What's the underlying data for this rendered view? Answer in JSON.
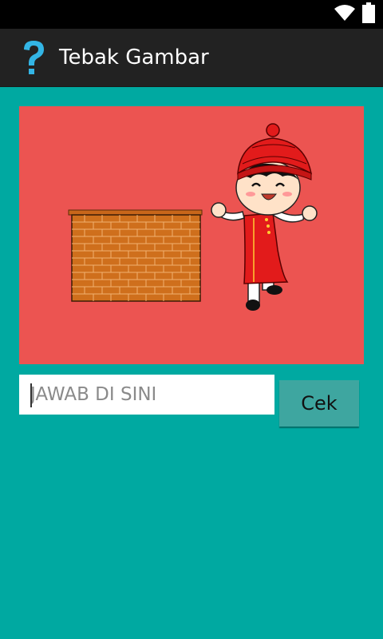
{
  "status_bar": {
    "icons": [
      "wifi-icon",
      "battery-icon"
    ]
  },
  "action_bar": {
    "icon": "question-mark-icon",
    "title": "Tebak Gambar"
  },
  "puzzle": {
    "image_description_icons": [
      "brick-wall",
      "boy-in-red-costume"
    ],
    "background_color": "#ec5451"
  },
  "answer": {
    "placeholder": "JAWAB DI SINI",
    "value": ""
  },
  "check_button": {
    "label": "Cek"
  },
  "colors": {
    "background": "#00a9a1",
    "action_bar": "#222222",
    "accent_icon": "#33b5e5",
    "button": "#3ea6a0"
  }
}
